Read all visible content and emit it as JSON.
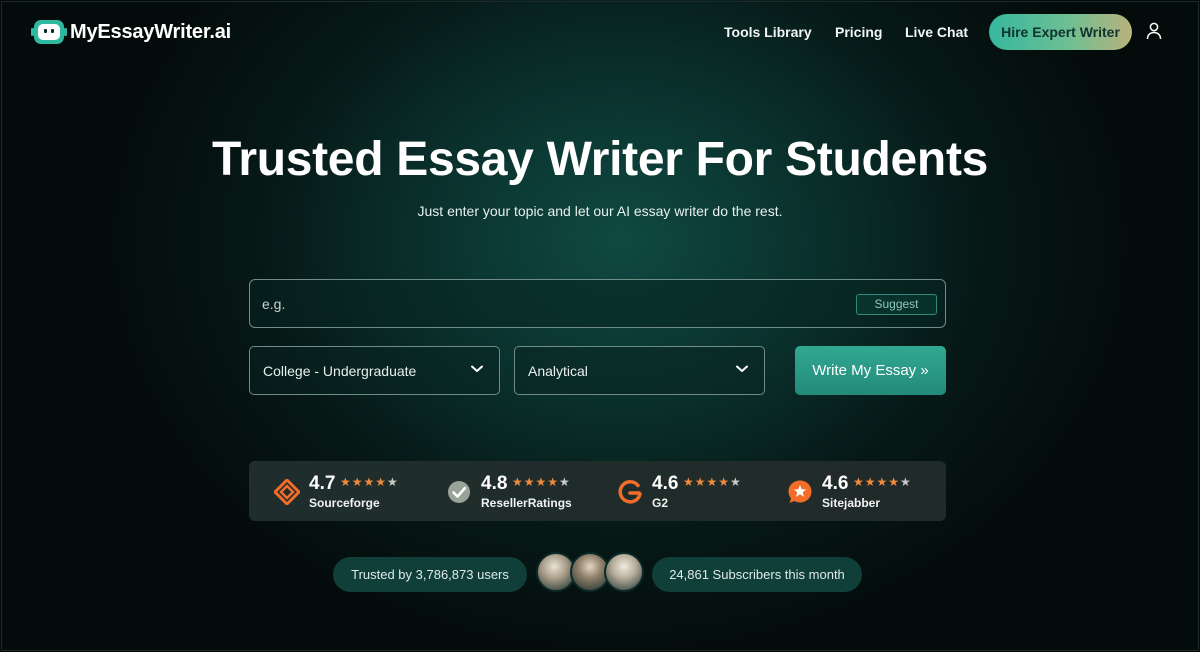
{
  "brand": {
    "name": "MyEssayWriter.ai"
  },
  "nav": {
    "links": [
      "Tools Library",
      "Pricing",
      "Live Chat"
    ],
    "cta": "Hire Expert Writer"
  },
  "hero": {
    "title": "Trusted Essay Writer For Students",
    "subtitle": "Just enter your topic and let our AI essay writer do the rest."
  },
  "form": {
    "topic_placeholder": "e.g.",
    "suggest_label": "Suggest",
    "level_value": "College - Undergraduate",
    "type_value": "Analytical",
    "submit_label": "Write My Essay »"
  },
  "ratings": [
    {
      "score": "4.7",
      "name": "Sourceforge",
      "stars": 4.5,
      "icon": "sourceforge-icon",
      "color": "#f26c2a"
    },
    {
      "score": "4.8",
      "name": "ResellerRatings",
      "stars": 4.5,
      "icon": "resellerratings-icon",
      "color": "#9aa39a"
    },
    {
      "score": "4.6",
      "name": "G2",
      "stars": 4.5,
      "icon": "g2-icon",
      "color": "#f26c2a"
    },
    {
      "score": "4.6",
      "name": "Sitejabber",
      "stars": 4.5,
      "icon": "sitejabber-icon",
      "color": "#f26c2a"
    }
  ],
  "trust": {
    "users_text": "Trusted by 3,786,873 users",
    "subscribers_text": "24,861 Subscribers this month"
  },
  "colors": {
    "accent": "#2fb8a0",
    "star": "#f08a3c",
    "background": "#061816"
  }
}
